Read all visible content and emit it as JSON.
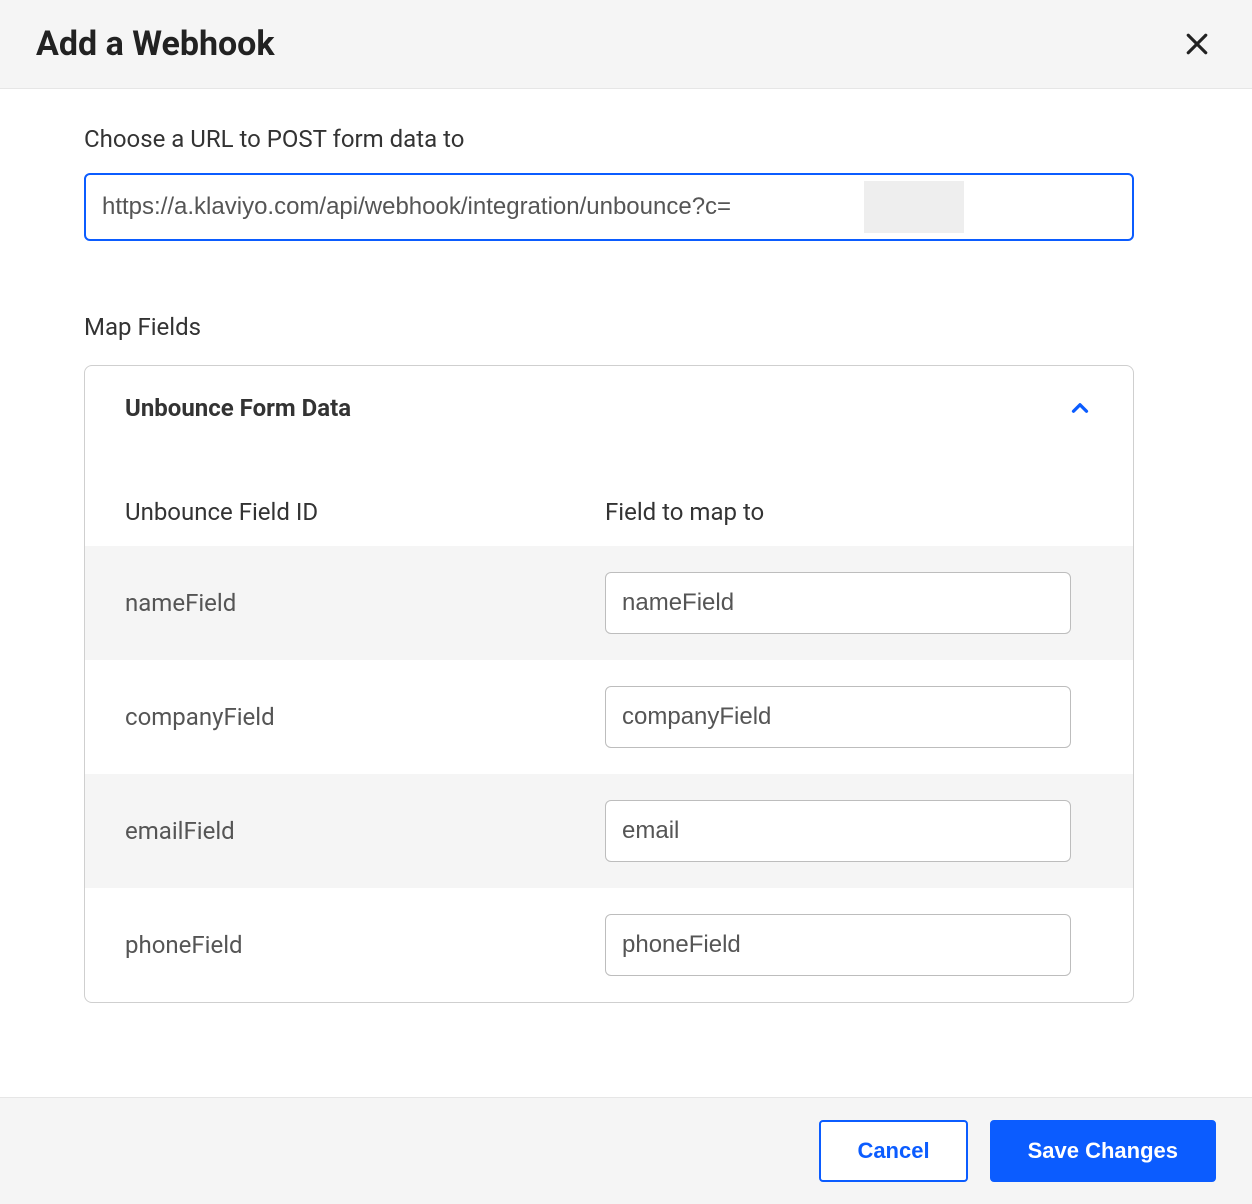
{
  "header": {
    "title": "Add a Webhook"
  },
  "urlSection": {
    "label": "Choose a URL to POST form data to",
    "value": "https://a.klaviyo.com/api/webhook/integration/unbounce?c="
  },
  "mapFields": {
    "label": "Map Fields",
    "panelTitle": "Unbounce Form Data",
    "columns": {
      "left": "Unbounce Field ID",
      "right": "Field to map to"
    },
    "rows": [
      {
        "id": "nameField",
        "map": "nameField"
      },
      {
        "id": "companyField",
        "map": "companyField"
      },
      {
        "id": "emailField",
        "map": "email"
      },
      {
        "id": "phoneField",
        "map": "phoneField"
      }
    ]
  },
  "footer": {
    "cancel": "Cancel",
    "save": "Save Changes"
  },
  "colors": {
    "accent": "#0b5cff"
  }
}
